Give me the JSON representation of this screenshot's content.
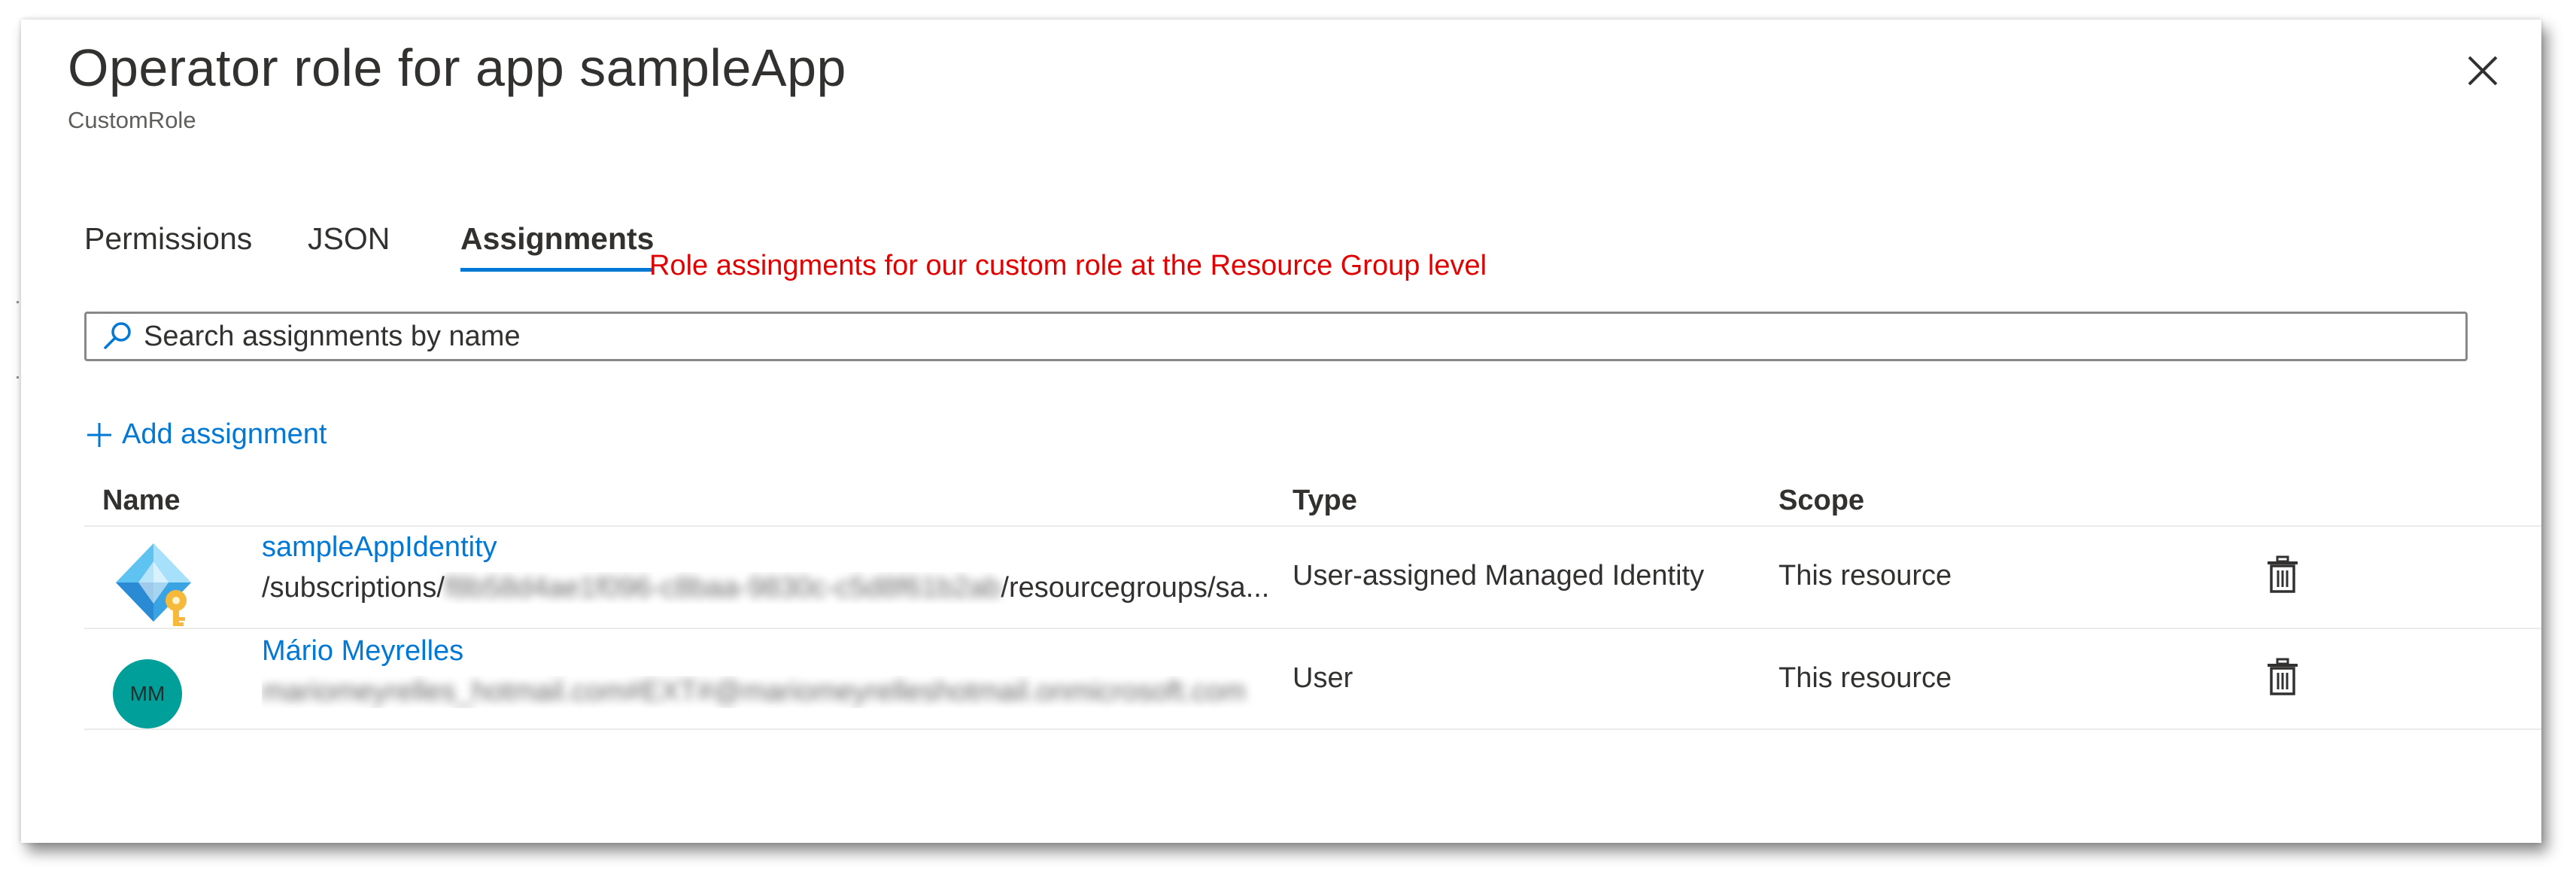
{
  "header": {
    "title": "Operator role for app sampleApp",
    "subtitle": "CustomRole",
    "close_icon": "close-icon"
  },
  "tabs": [
    {
      "label": "Permissions",
      "active": false
    },
    {
      "label": "JSON",
      "active": false
    },
    {
      "label": "Assignments",
      "active": true
    }
  ],
  "annotation": "Role assingments for our custom role at the Resource Group level",
  "search": {
    "placeholder": "Search assignments by name",
    "icon": "search-icon"
  },
  "add_assignment_label": "Add assignment",
  "table": {
    "columns": [
      "Name",
      "Type",
      "Scope"
    ],
    "rows": [
      {
        "name": "sampleAppIdentity",
        "detail_prefix": "/subscriptions/",
        "detail_redacted": "f8b58d4ae1f096-c8baa-9830c-c5d8f61b2ab",
        "detail_suffix": "/resourcegroups/sa...",
        "type": "User-assigned Managed Identity",
        "scope": "This resource",
        "icon": "managed-identity-icon"
      },
      {
        "name": "Mário Meyrelles",
        "avatar_initials": "MM",
        "detail_redacted": "mariomeyrelles_hotmail.com#EXT#@mariomeyrelleshotmail.onmicrosoft.com",
        "type": "User",
        "scope": "This resource",
        "icon": "user-avatar"
      }
    ]
  },
  "colors": {
    "accent": "#0078d4",
    "annotation": "#e00000",
    "avatar": "#009f9a"
  }
}
